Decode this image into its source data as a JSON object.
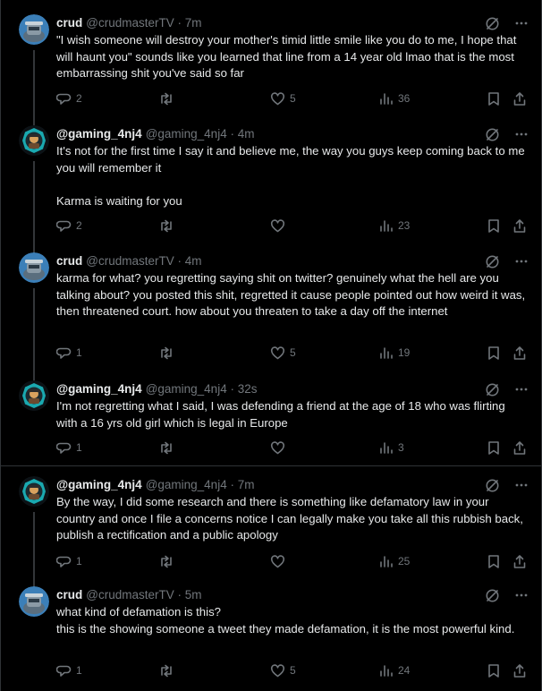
{
  "tweets": [
    {
      "name": "crud",
      "handle": "@crudmasterTV · 7m",
      "text": "\"I wish someone will destroy your mother's timid little smile like you do to me, I hope that will haunt you\" sounds like you learned that line from a 14 year old lmao that is the most embarrassing shit you've said so far",
      "replies": "2",
      "reposts": "",
      "likes": "5",
      "views": "36",
      "avatar": "crud"
    },
    {
      "name": "@gaming_4nj4",
      "handle": "@gaming_4nj4 · 4m",
      "text": "It's not for the first time I say it and believe me, the way you guys keep coming back to me you will remember it\n\nKarma is waiting for you",
      "replies": "2",
      "reposts": "",
      "likes": "",
      "views": "23",
      "avatar": "gaming"
    },
    {
      "name": "crud",
      "handle": "@crudmasterTV · 4m",
      "text": "karma for what? you regretting saying shit on twitter? genuinely what the hell are you talking about? you posted this shit, regretted it cause people pointed out how weird it was, then threatened court. how about you threaten to take a day off the internet",
      "replies": "1",
      "reposts": "",
      "likes": "5",
      "views": "19",
      "avatar": "crud"
    },
    {
      "name": "@gaming_4nj4",
      "handle": "@gaming_4nj4 · 32s",
      "text": "I'm not regretting what I said, I was defending a friend at the age of 18 who was flirting with a 16 yrs old girl which is legal in Europe",
      "replies": "1",
      "reposts": "",
      "likes": "",
      "views": "3",
      "avatar": "gaming"
    },
    {
      "name": "@gaming_4nj4",
      "handle": "@gaming_4nj4 · 7m",
      "text": "By the way, I did some research and there is something like defamatory law in your country and once I file a concerns notice I can legally make you take all this rubbish back, publish a rectification and a public apology",
      "replies": "1",
      "reposts": "",
      "likes": "",
      "views": "25",
      "avatar": "gaming"
    },
    {
      "name": "crud",
      "handle": "@crudmasterTV · 5m",
      "text": "what kind of defamation is this?\nthis is the showing someone a tweet they made defamation, it is the most powerful kind.",
      "replies": "1",
      "reposts": "",
      "likes": "5",
      "views": "24",
      "avatar": "crud"
    }
  ],
  "icons": {
    "grok": "grok-icon",
    "more": "more-options-icon",
    "reply": "reply-icon",
    "repost": "repost-icon",
    "like": "like-icon",
    "views": "views-icon",
    "bookmark": "bookmark-icon",
    "share": "share-icon"
  },
  "colors": {
    "background": "#000000",
    "text": "#e7e9ea",
    "muted": "#71767b",
    "border": "#2f3336"
  }
}
